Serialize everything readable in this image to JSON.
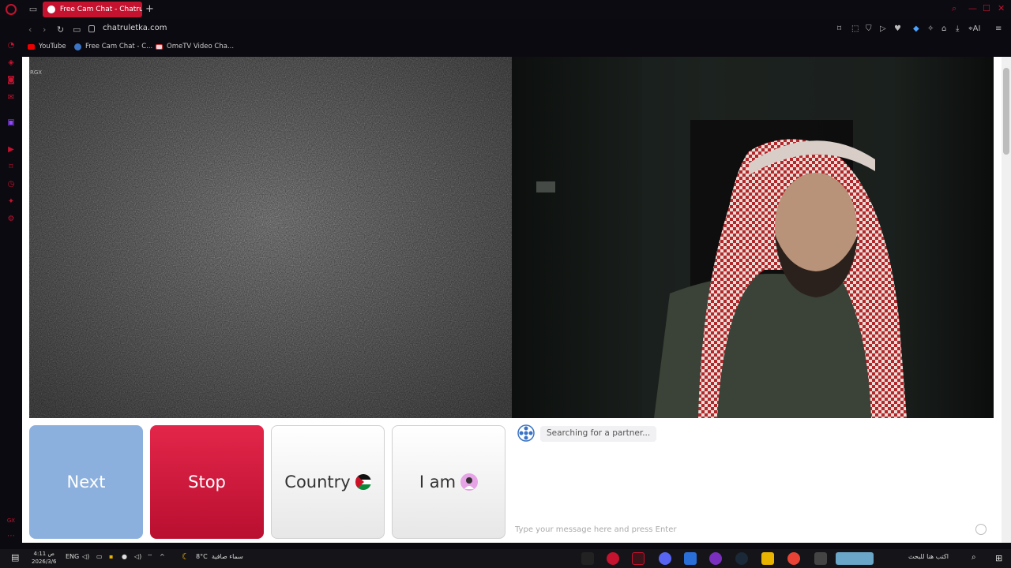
{
  "browser": {
    "active_tab_title": "Free Cam Chat - Chatru",
    "new_tab_symbol": "+",
    "url": "chatruletka.com",
    "bookmarks": [
      {
        "label": "YouTube",
        "color": "#e00"
      },
      {
        "label": "Free Cam Chat - C...",
        "color": "#3b74c6"
      },
      {
        "label": "OmeTV Video Cha...",
        "color": "#e9b"
      }
    ],
    "ai_label": "AI"
  },
  "page": {
    "watermark": "RGX",
    "buttons": {
      "next": "Next",
      "stop": "Stop",
      "country": "Country",
      "iam": "I am"
    },
    "chat": {
      "status": "Searching for a partner...",
      "input_placeholder": "Type your message here and press Enter"
    }
  },
  "taskbar": {
    "time": "4:11 ص",
    "date": "2026/3/6",
    "language": "ENG",
    "weather_temp": "8°C",
    "weather_text": "سماء صافية",
    "search_placeholder": "اكتب هنا للبحث"
  },
  "colors": {
    "accent": "#c4122f",
    "next_button": "#8cb0dd",
    "stop_button": "#d91a3e"
  }
}
